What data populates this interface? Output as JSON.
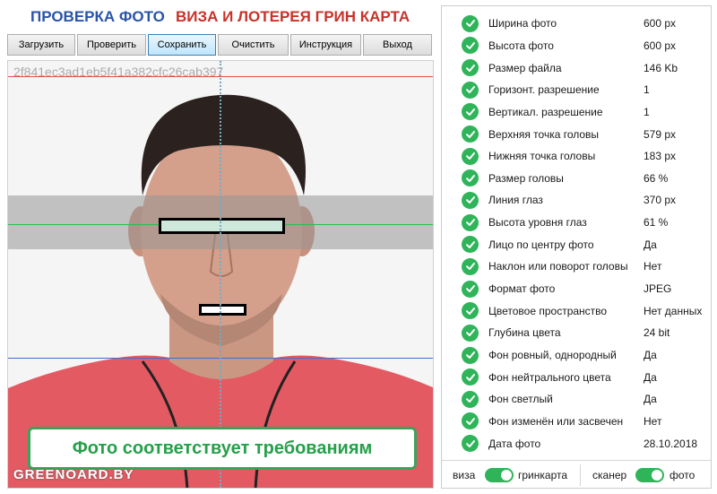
{
  "header": {
    "title_left": "ПРОВЕРКА ФОТО",
    "title_right": "ВИЗА И ЛОТЕРЕЯ ГРИН КАРТА"
  },
  "toolbar": {
    "buttons": [
      {
        "label": "Загрузить"
      },
      {
        "label": "Проверить"
      },
      {
        "label": "Сохранить",
        "active": true
      },
      {
        "label": "Очистить"
      },
      {
        "label": "Инструкция"
      },
      {
        "label": "Выход"
      }
    ]
  },
  "photo": {
    "hash": "2f841ec3ad1eb5f41a382cfc26cab397",
    "watermark": "GREENOARD.BY",
    "result_text": "Фото соответствует требованиям",
    "line_colors": {
      "top": "#e05050",
      "eyes": "#27c04a",
      "bottom": "#3b6fd0"
    }
  },
  "checks": [
    {
      "label": "Ширина фото",
      "value": "600 px",
      "status": "ok"
    },
    {
      "label": "Высота фото",
      "value": "600 px",
      "status": "ok"
    },
    {
      "label": "Размер файла",
      "value": "146 Kb",
      "status": "ok"
    },
    {
      "label": "Горизонт. разрешение",
      "value": "1",
      "status": "ok"
    },
    {
      "label": "Вертикал. разрешение",
      "value": "1",
      "status": "ok"
    },
    {
      "label": "Верхняя точка головы",
      "value": "579 px",
      "status": "ok"
    },
    {
      "label": "Нижняя точка головы",
      "value": "183 px",
      "status": "ok"
    },
    {
      "label": "Размер головы",
      "value": "66 %",
      "status": "ok"
    },
    {
      "label": "Линия глаз",
      "value": "370 px",
      "status": "ok"
    },
    {
      "label": "Высота уровня глаз",
      "value": "61 %",
      "status": "ok"
    },
    {
      "label": "Лицо по центру фото",
      "value": "Да",
      "status": "ok"
    },
    {
      "label": "Наклон или поворот головы",
      "value": "Нет",
      "status": "ok"
    },
    {
      "label": "Формат фото",
      "value": "JPEG",
      "status": "ok"
    },
    {
      "label": "Цветовое пространство",
      "value": "Нет данных",
      "status": "ok"
    },
    {
      "label": "Глубина цвета",
      "value": "24 bit",
      "status": "ok"
    },
    {
      "label": "Фон ровный, однородный",
      "value": "Да",
      "status": "ok"
    },
    {
      "label": "Фон нейтрального цвета",
      "value": "Да",
      "status": "ok"
    },
    {
      "label": "Фон светлый",
      "value": "Да",
      "status": "ok"
    },
    {
      "label": "Фон изменён или засвечен",
      "value": "Нет",
      "status": "ok"
    },
    {
      "label": "Дата фото",
      "value": "28.10.2018",
      "status": "ok"
    }
  ],
  "switches": {
    "mode_left": "виза",
    "mode_right": "гринкарта",
    "mode_on": true,
    "source_left": "сканер",
    "source_right": "фото",
    "source_on": true
  },
  "colors": {
    "accent_green": "#2fb45a",
    "title_blue": "#2a54a8",
    "title_red": "#c8322a"
  }
}
